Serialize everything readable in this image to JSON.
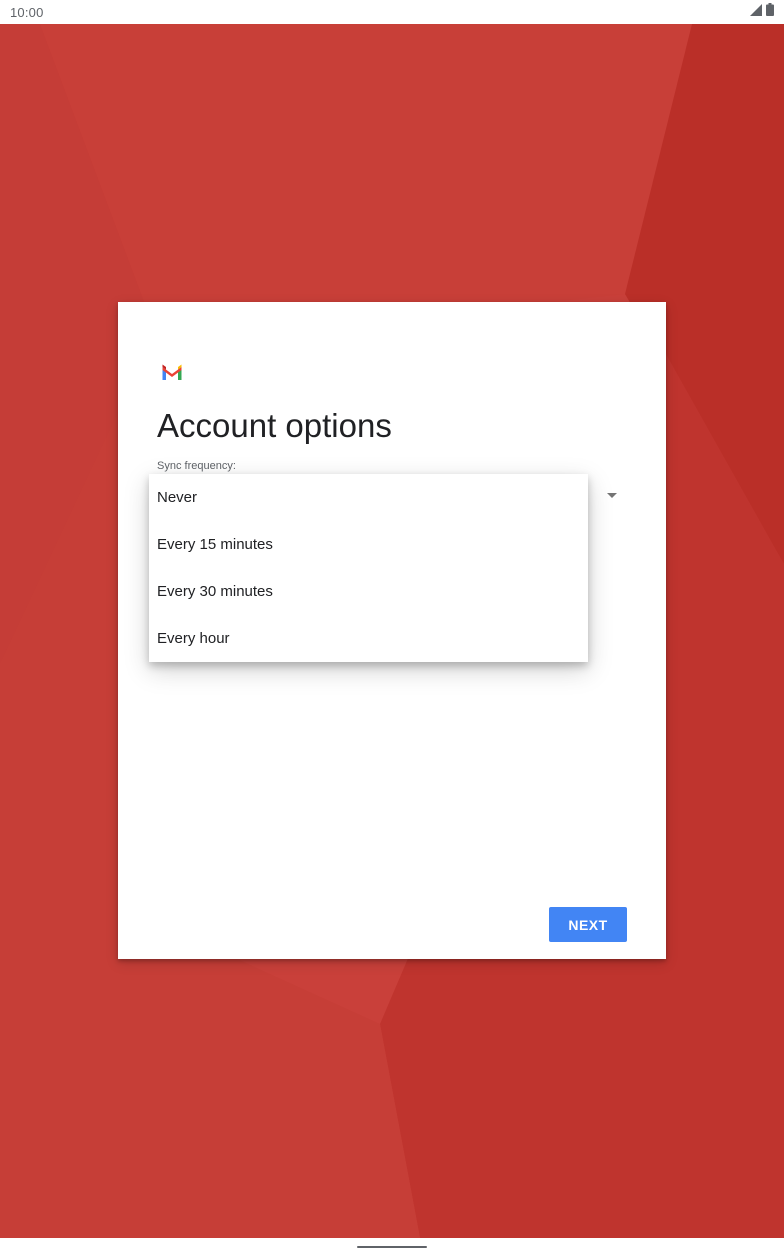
{
  "status_bar": {
    "time": "10:00",
    "icons": [
      "signal-icon",
      "battery-icon"
    ]
  },
  "card": {
    "logo_icon": "gmail-logo-icon",
    "title": "Account options",
    "sync_label": "Sync frequency:",
    "next_label": "NEXT"
  },
  "menu": {
    "items": [
      {
        "label": "Never"
      },
      {
        "label": "Every 15 minutes"
      },
      {
        "label": "Every 30 minutes"
      },
      {
        "label": "Every hour"
      }
    ]
  },
  "colors": {
    "background": "#c9403a",
    "accent": "#4285f4",
    "text": "#202124"
  }
}
